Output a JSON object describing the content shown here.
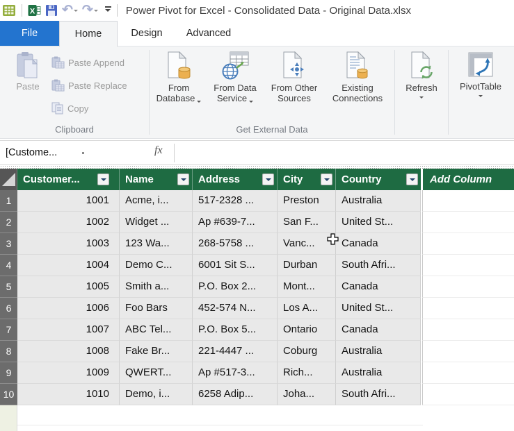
{
  "title_bar": {
    "title": "Power Pivot for Excel - Consolidated Data - Original Data.xlsx"
  },
  "tabs": {
    "file": "File",
    "home": "Home",
    "design": "Design",
    "advanced": "Advanced"
  },
  "ribbon": {
    "clipboard": {
      "paste": "Paste",
      "paste_append": "Paste Append",
      "paste_replace": "Paste Replace",
      "copy": "Copy",
      "label": "Clipboard"
    },
    "get_external": {
      "from_database_1": "From",
      "from_database_2": "Database",
      "from_data_service_1": "From Data",
      "from_data_service_2": "Service",
      "from_other_1": "From Other",
      "from_other_2": "Sources",
      "existing_1": "Existing",
      "existing_2": "Connections",
      "label": "Get External Data"
    },
    "refresh": "Refresh",
    "pivottable": "PivotTable"
  },
  "formula_bar": {
    "name_box": "[Custome...",
    "fx": "fx",
    "formula": ""
  },
  "grid": {
    "headers": [
      "Customer...",
      "Name",
      "Address",
      "City",
      "Country"
    ],
    "add_column": "Add Column",
    "rows": [
      {
        "n": "1",
        "cells": [
          "1001",
          "Acme, i...",
          "517-2328 ...",
          "Preston",
          "Australia"
        ]
      },
      {
        "n": "2",
        "cells": [
          "1002",
          "Widget ...",
          "Ap #639-7...",
          "San F...",
          "United St..."
        ]
      },
      {
        "n": "3",
        "cells": [
          "1003",
          "123 Wa...",
          "268-5758 ...",
          "Vanc...",
          "Canada"
        ]
      },
      {
        "n": "4",
        "cells": [
          "1004",
          "Demo C...",
          "6001 Sit S...",
          "Durban",
          "South Afri..."
        ]
      },
      {
        "n": "5",
        "cells": [
          "1005",
          "Smith a...",
          "P.O. Box 2...",
          "Mont...",
          "Canada"
        ]
      },
      {
        "n": "6",
        "cells": [
          "1006",
          "Foo Bars",
          "452-574 N...",
          "Los A...",
          "United St..."
        ]
      },
      {
        "n": "7",
        "cells": [
          "1007",
          "ABC Tel...",
          "P.O. Box 5...",
          "Ontario",
          "Canada"
        ]
      },
      {
        "n": "8",
        "cells": [
          "1008",
          "Fake Br...",
          "221-4447 ...",
          "Coburg",
          "Australia"
        ]
      },
      {
        "n": "9",
        "cells": [
          "1009",
          "QWERT...",
          "Ap #517-3...",
          "Rich...",
          "Australia"
        ]
      },
      {
        "n": "10",
        "cells": [
          "1010",
          "Demo, i...",
          "6258 Adip...",
          "Joha...",
          "South Afri..."
        ]
      }
    ]
  },
  "colors": {
    "header_green": "#1e6b42",
    "file_tab_blue": "#2374cf",
    "row_header_gray": "#6c6c6c",
    "cell_gray": "#e9e9e9",
    "db_cylinder_amber": "#ecb050",
    "service_blue": "#4a7ebb",
    "refresh_green": "#67a567",
    "pivot_arrow_blue": "#2e75b6"
  }
}
